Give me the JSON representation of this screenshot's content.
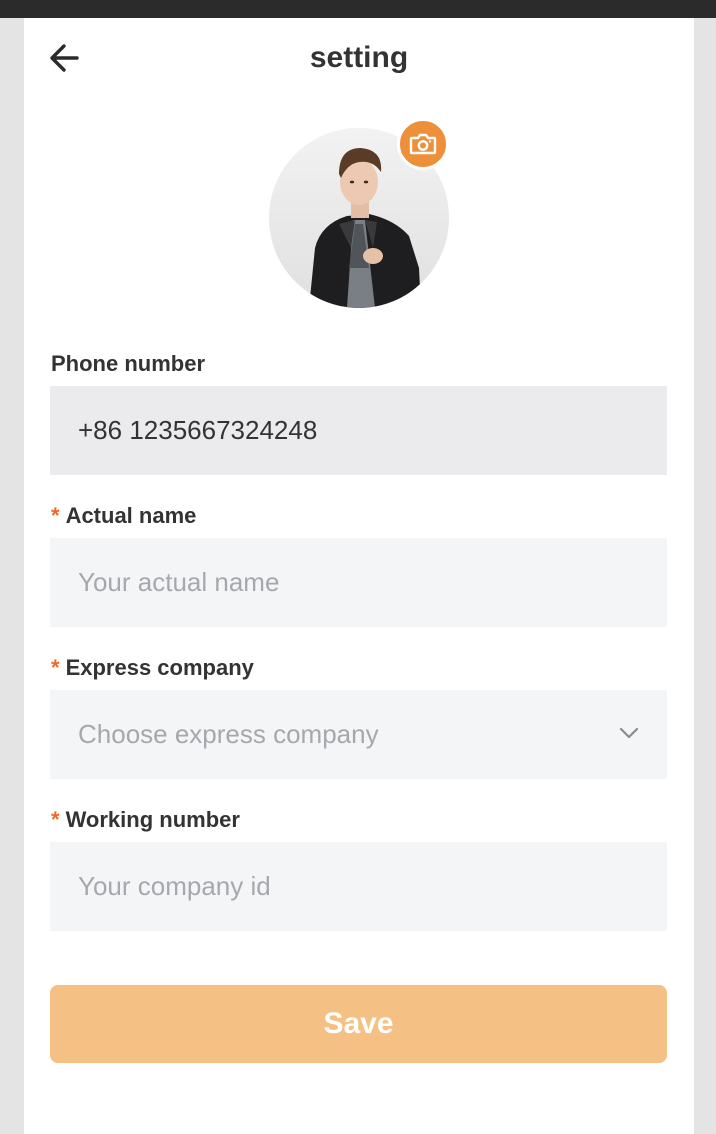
{
  "status_bar": {
    "color": "#2b2b2b"
  },
  "header": {
    "title": "setting",
    "back_icon": "arrow-left-icon"
  },
  "profile": {
    "avatar_alt": "profile photo",
    "camera_icon": "camera-icon",
    "badge_color": "#ee8f3a"
  },
  "form": {
    "phone": {
      "label": "Phone number",
      "value": "+86 1235667324248"
    },
    "actual_name": {
      "required_mark": "*",
      "label": "Actual name",
      "placeholder": "Your actual name",
      "value": ""
    },
    "express_company": {
      "required_mark": "*",
      "label": "Express company",
      "placeholder": "Choose express company",
      "chevron_icon": "chevron-down-icon"
    },
    "working_number": {
      "required_mark": "*",
      "label": "Working number",
      "placeholder": "Your company id",
      "value": ""
    }
  },
  "actions": {
    "save_label": "Save",
    "save_color": "#f5c083"
  },
  "colors": {
    "accent": "#ee8f3a",
    "required": "#ee6a2a",
    "readonly_bg": "#ebebed",
    "input_bg": "#f4f5f7"
  }
}
